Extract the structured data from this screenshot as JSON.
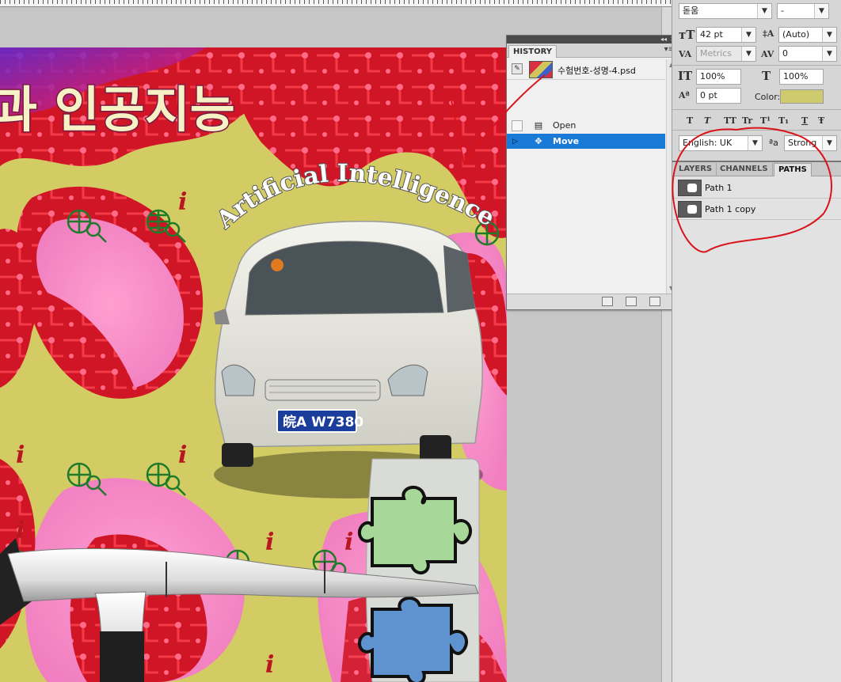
{
  "history": {
    "title": "HISTORY",
    "document_name": "수험번호-성명-4.psd",
    "items": [
      {
        "label": "Open",
        "icon": "document-icon"
      },
      {
        "label": "Move",
        "icon": "move-tool-icon",
        "selected": true
      }
    ],
    "selection_color": "#1a7ad7"
  },
  "character": {
    "font_family": "돋움",
    "font_style": "-",
    "font_size": "42 pt",
    "leading": "(Auto)",
    "kerning": "Metrics",
    "tracking": "0",
    "vertical_scale": "100%",
    "horizontal_scale": "100%",
    "baseline_shift": "0 pt",
    "color_label": "Color:",
    "color_value": "#cdcb6d",
    "style_buttons": [
      "T",
      "T",
      "TT",
      "Tr",
      "T¹",
      "T₁",
      "T",
      "Ŧ"
    ],
    "language": "English: UK",
    "aa_label": "ªa",
    "anti_alias": "Strong"
  },
  "paths_panel": {
    "tabs": [
      "LAYERS",
      "CHANNELS",
      "PATHS"
    ],
    "active_tab": "PATHS",
    "paths": [
      "Path 1",
      "Path 1 copy"
    ]
  },
  "canvas": {
    "heading_korean": "과 인공지능",
    "arc_text": "Artificial Intelligence",
    "license_plate": "皖A W7380",
    "info_letter": "i"
  }
}
